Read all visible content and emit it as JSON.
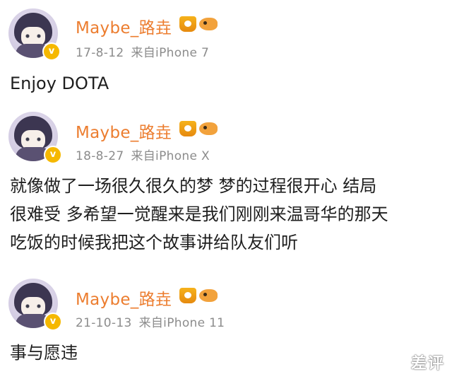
{
  "posts": [
    {
      "username": "Maybe_路垚",
      "date": "17-8-12",
      "source": "来自iPhone 7",
      "content": [
        "Enjoy DOTA"
      ]
    },
    {
      "username": "Maybe_路垚",
      "date": "18-8-27",
      "source": "来自iPhone X",
      "content": [
        "就像做了一场很久很久的梦 梦的过程很开心 结局",
        "很难受 多希望一觉醒来是我们刚刚来温哥华的那天",
        "吃饭的时候我把这个故事讲给队友们听"
      ]
    },
    {
      "username": "Maybe_路垚",
      "date": "21-10-13",
      "source": "来自iPhone 11",
      "content": [
        "事与愿违"
      ]
    }
  ],
  "badge_label": "v",
  "watermark": "差评",
  "colors": {
    "username": "#ec7d2f",
    "meta": "#8c8c8c",
    "badge": "#f5b800"
  }
}
